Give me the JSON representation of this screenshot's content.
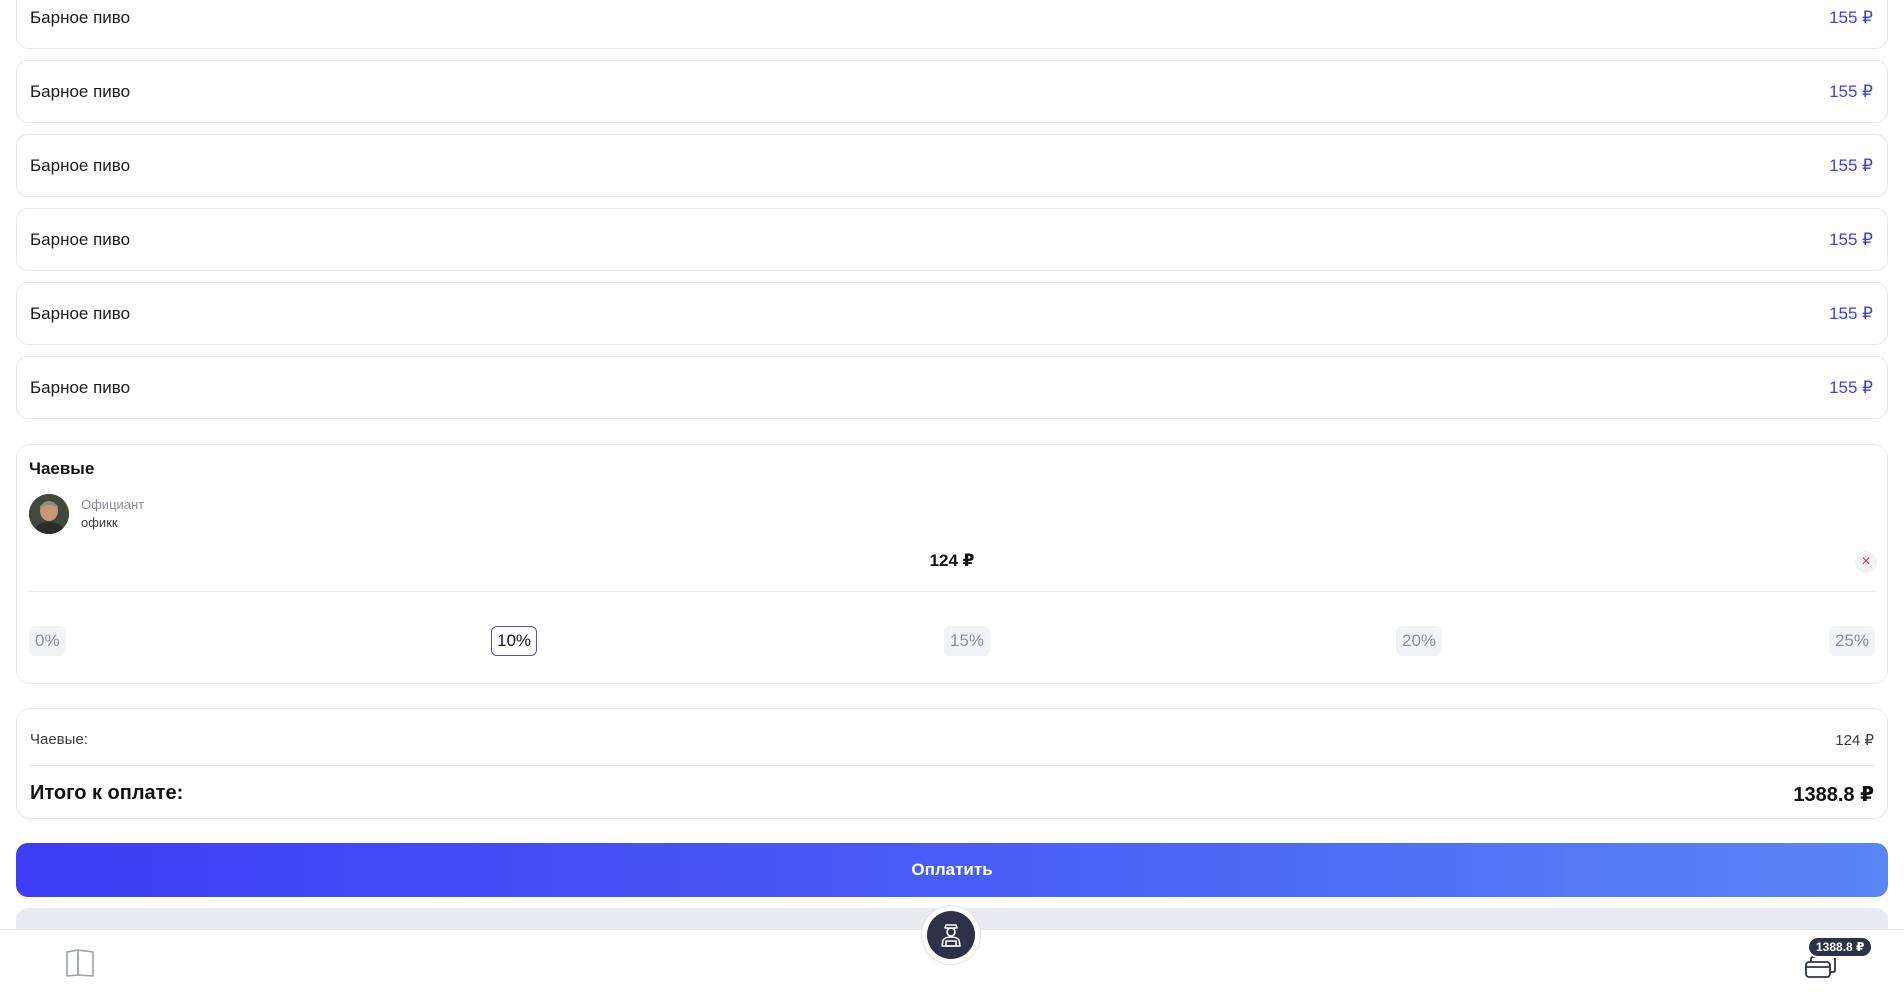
{
  "items": [
    {
      "name": "Барное пиво",
      "price": "155 ₽"
    },
    {
      "name": "Барное пиво",
      "price": "155 ₽"
    },
    {
      "name": "Барное пиво",
      "price": "155 ₽"
    },
    {
      "name": "Барное пиво",
      "price": "155 ₽"
    },
    {
      "name": "Барное пиво",
      "price": "155 ₽"
    },
    {
      "name": "Барное пиво",
      "price": "155 ₽"
    }
  ],
  "tips": {
    "title": "Чаевые",
    "waiter_role": "Официант",
    "waiter_name": "офикк",
    "amount": "124 ₽",
    "clear_icon": "×",
    "options": [
      "0%",
      "10%",
      "15%",
      "20%",
      "25%"
    ],
    "selected": "10%"
  },
  "summary": {
    "tips_label": "Чаевые:",
    "tips_value": "124 ₽",
    "total_label": "Итого к оплате:",
    "total_value": "1388.8 ₽"
  },
  "pay_button": "Оплатить",
  "bottom_nav": {
    "menu_icon": "book-icon",
    "waiter_icon": "waiter-icon",
    "bill_icon": "card-icon",
    "bill_badge": "1388.8 ₽"
  },
  "colors": {
    "accent": "#3d3df0",
    "button_gradient_start": "#3d3cf6",
    "button_gradient_end": "#5a86f6",
    "nav_dark": "#2c3247",
    "clear_red": "#e03d3d"
  }
}
